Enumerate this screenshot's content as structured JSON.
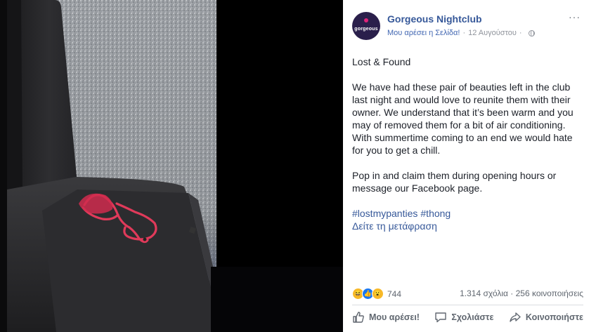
{
  "page": {
    "name": "Gorgeous Nightclub",
    "avatar_text": "gorgeous",
    "like_page": "Μου αρέσει η Σελίδα!",
    "separator": "·",
    "date": "12 Αυγούστου",
    "options_label": "···"
  },
  "post": {
    "paragraphs": [
      "Lost & Found",
      "We have had these pair of beauties left in the club last night and would love to reunite them with their owner. We understand that it’s been warm and you may of removed them for a bit of air conditioning. With summertime coming to an end we would hate for you to get a chill.",
      "Pop in and claim them during opening hours or message our Facebook page."
    ],
    "hashtags": [
      "#lostmypanties",
      "#thong"
    ],
    "see_translation": "Δείτε τη μετάφραση"
  },
  "reactions": {
    "count": "744",
    "comments": "1.314 σχόλια",
    "shares": "256 κοινοποιήσεις"
  },
  "actions": {
    "like": "Μου αρέσει!",
    "comment": "Σχολιάστε",
    "share": "Κοινοποιήστε"
  },
  "colors": {
    "link": "#365899",
    "meta": "#90949c",
    "avatar_bg": "#2a1f4b",
    "accent": "#e0247a"
  }
}
